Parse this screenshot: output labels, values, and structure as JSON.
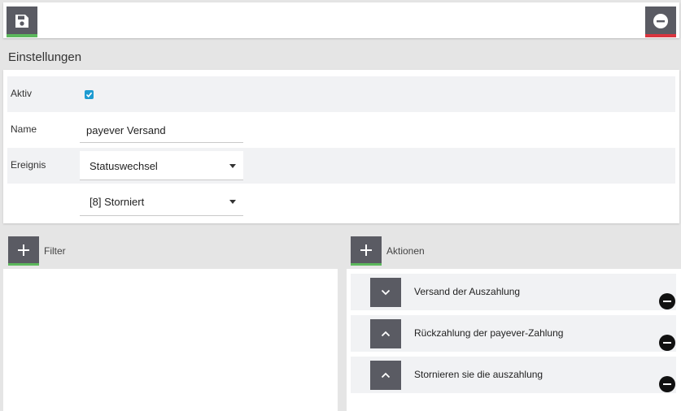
{
  "toolbar": {
    "save_icon": "save-icon",
    "remove_icon": "minus-circle-icon",
    "save_accent": "#5cb85c",
    "remove_accent": "#d9353f"
  },
  "settings": {
    "title": "Einstellungen",
    "active_label": "Aktiv",
    "active_checked": true,
    "name_label": "Name",
    "name_value": "payever Versand",
    "event_label": "Ereignis",
    "event_value": "Statuswechsel",
    "status_value": "[8] Storniert"
  },
  "filter": {
    "label": "Filter"
  },
  "actions": {
    "label": "Aktionen",
    "items": [
      {
        "label": "Versand der Auszahlung",
        "toggle": "chevron-down-icon"
      },
      {
        "label": "Rückzahlung der payever-Zahlung",
        "toggle": "chevron-up-icon"
      },
      {
        "label": "Stornieren sie die auszahlung",
        "toggle": "chevron-up-icon"
      }
    ]
  },
  "colors": {
    "button_bg": "#5a5b63",
    "checkbox": "#1d9bd1",
    "page_bg": "#e5e5e5",
    "row_bg": "#f1f2f4"
  }
}
